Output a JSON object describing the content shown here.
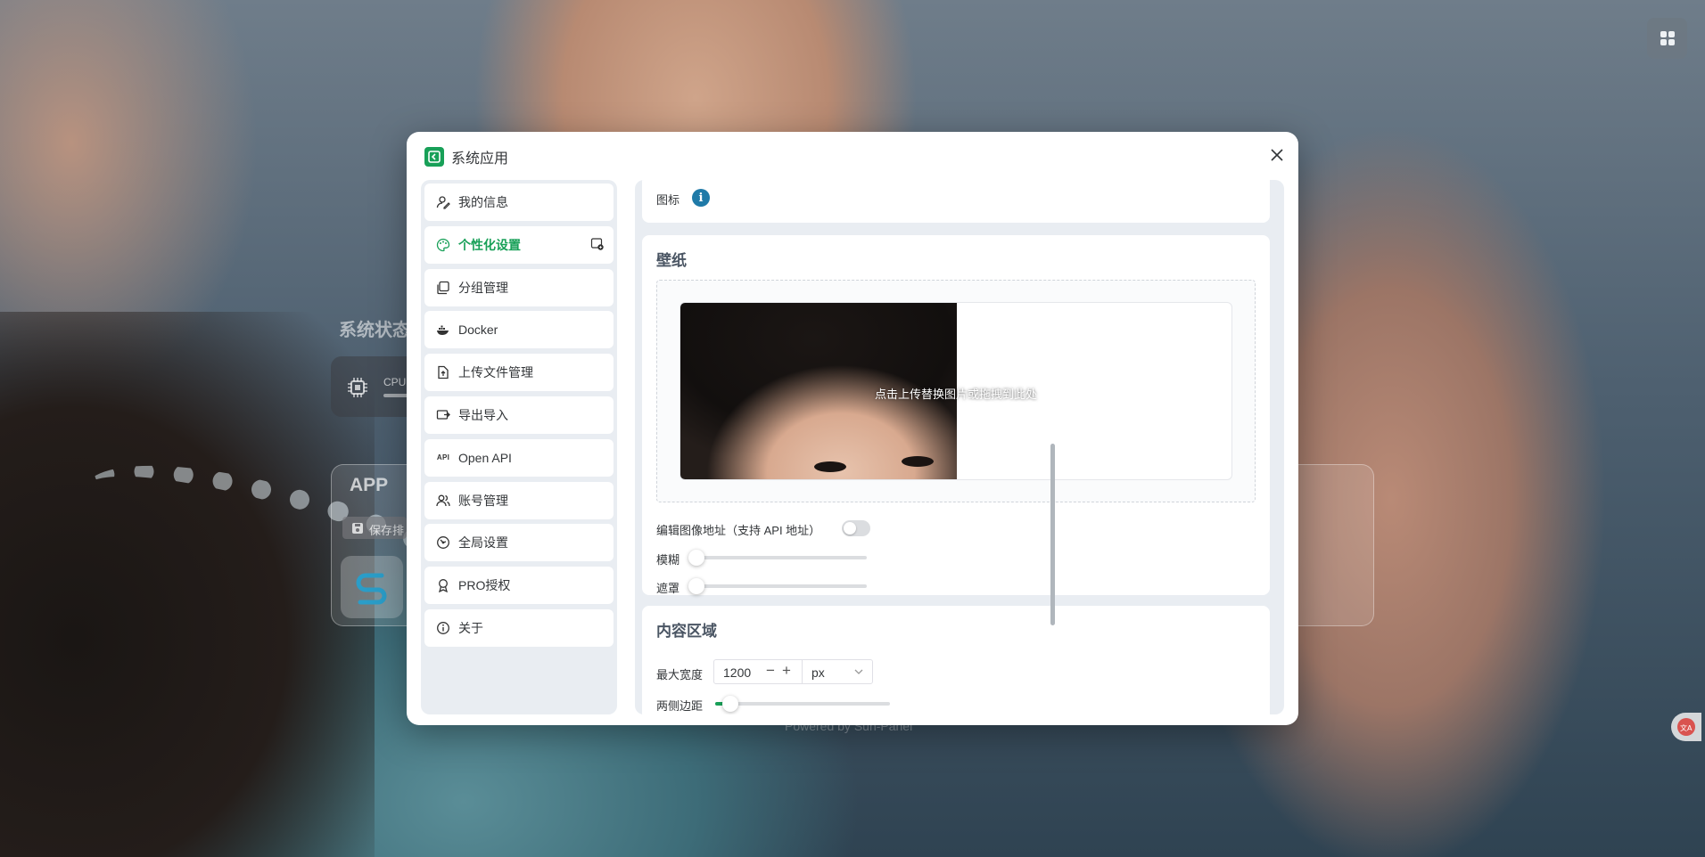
{
  "background": {
    "dashboard_title": "系统状态",
    "cpu_label": "CPU",
    "app_section_title": "APP",
    "save_button": "保存排",
    "footer": "Powered by Sun-Panel"
  },
  "modal": {
    "title": "系统应用",
    "accent_color": "#18a058",
    "sidebar": {
      "items": [
        {
          "label": "我的信息",
          "icon": "user-edit-icon"
        },
        {
          "label": "个性化设置",
          "icon": "palette-icon",
          "active": true
        },
        {
          "label": "分组管理",
          "icon": "layers-icon"
        },
        {
          "label": "Docker",
          "icon": "docker-whale-icon"
        },
        {
          "label": "上传文件管理",
          "icon": "file-upload-icon"
        },
        {
          "label": "导出导入",
          "icon": "import-export-icon"
        },
        {
          "label": "Open API",
          "icon": "api-icon",
          "icon_text": "API"
        },
        {
          "label": "账号管理",
          "icon": "users-icon"
        },
        {
          "label": "全局设置",
          "icon": "settings-icon"
        },
        {
          "label": "PRO授权",
          "icon": "badge-icon"
        },
        {
          "label": "关于",
          "icon": "info-circle-icon"
        }
      ]
    },
    "icon_section": {
      "label": "图标",
      "info_glyph": "i"
    },
    "wallpaper": {
      "title": "壁纸",
      "upload_hint": "点击上传替换图片或拖拽到此处",
      "edit_url_label": "编辑图像地址（支持 API 地址）",
      "edit_url_enabled": false,
      "blur_label": "模糊",
      "blur_value": 0,
      "mask_label": "遮罩",
      "mask_value": 0
    },
    "content_area": {
      "title": "内容区域",
      "max_width_label": "最大宽度",
      "max_width_value": "1200",
      "minus_glyph": "−",
      "plus_glyph": "+",
      "unit": "px",
      "side_margin_label": "两侧边距",
      "side_margin_fraction": 0.06
    }
  }
}
